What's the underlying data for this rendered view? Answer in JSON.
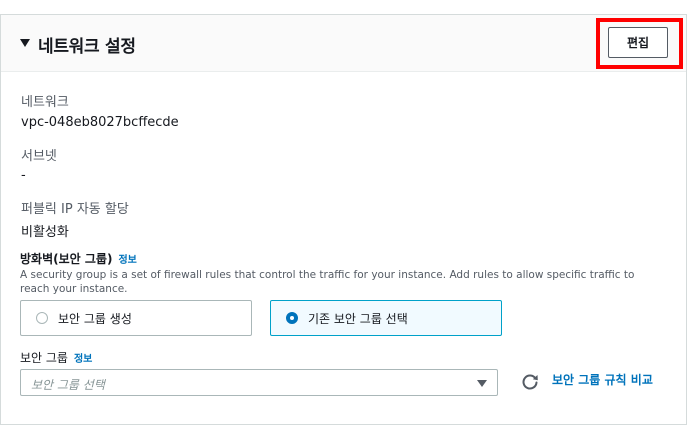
{
  "section": {
    "title": "네트워크 설정",
    "edit_label": "편집"
  },
  "fields": {
    "network": {
      "label": "네트워크",
      "value": "vpc-048eb8027bcffecde"
    },
    "subnet": {
      "label": "서브넷",
      "value": "-"
    },
    "public_ip": {
      "label": "퍼블릭 IP 자동 할당",
      "value": "비활성화"
    }
  },
  "security_group": {
    "title": "방화벽(보안 그룹)",
    "info_label": "정보",
    "description": "A security group is a set of firewall rules that control the traffic for your instance. Add rules to allow specific traffic to reach your instance.",
    "options": [
      {
        "label": "보안 그룹 생성",
        "selected": false
      },
      {
        "label": "기존 보안 그룹 선택",
        "selected": true
      }
    ],
    "select_label": "보안 그룹",
    "select_info": "정보",
    "select_placeholder": "보안 그룹 선택",
    "compare_link": "보안 그룹 규칙 비교"
  },
  "colors": {
    "link": "#0073bb",
    "highlight": "#ff0000",
    "selected_border": "#00a1c9",
    "selected_bg": "#f1faff"
  }
}
